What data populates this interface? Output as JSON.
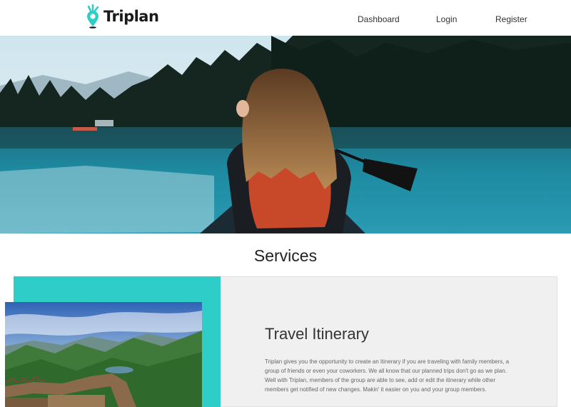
{
  "brand": {
    "name": "Triplan",
    "accent": "#2fcdc8"
  },
  "nav": {
    "links": [
      {
        "label": "Dashboard"
      },
      {
        "label": "Login"
      },
      {
        "label": "Register"
      }
    ]
  },
  "hero": {
    "image": "woman-kayaking-on-lake-photo"
  },
  "services": {
    "title": "Services",
    "card": {
      "heading": "Travel Itinerary",
      "body": "Triplan gives you the opportunity to create an itinerary if you are traveling with family members, a group of friends or even your coworkers. We all know that our planned trips don't go as we plan. Well with Triplan, members of the group are able to see, add or edit the itinerary while other members get notified of new changes. Makin' it easier on you and your group members.",
      "image": "great-wall-landscape-photo",
      "panel_color": "#f1f0f1"
    }
  }
}
